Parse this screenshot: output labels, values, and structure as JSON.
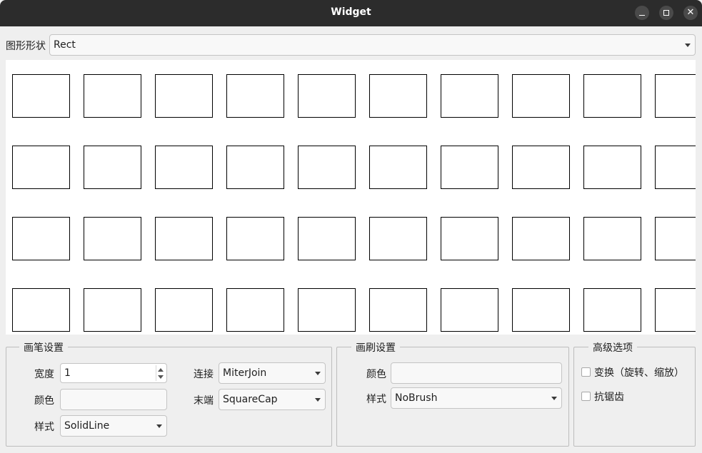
{
  "window": {
    "title": "Widget",
    "controls": {
      "minimize": "minimize-icon",
      "maximize": "maximize-icon",
      "close": "close-icon"
    }
  },
  "shape": {
    "label": "图形形状",
    "selected": "Rect"
  },
  "canvas": {
    "shape": "Rect",
    "rows": 4,
    "columns_visible": 10,
    "stroke_color": "#000000",
    "background": "#ffffff"
  },
  "pen": {
    "title": "画笔设置",
    "width_label": "宽度",
    "width_value": "1",
    "color_label": "颜色",
    "color_value": "",
    "style_label": "样式",
    "style_selected": "SolidLine",
    "join_label": "连接",
    "join_selected": "MiterJoin",
    "cap_label": "末端",
    "cap_selected": "SquareCap"
  },
  "brush": {
    "title": "画刷设置",
    "color_label": "颜色",
    "color_value": "",
    "style_label": "样式",
    "style_selected": "NoBrush"
  },
  "advanced": {
    "title": "高级选项",
    "transform_label": "变换（旋转、缩放）",
    "transform_checked": false,
    "antialias_label": "抗锯齿",
    "antialias_checked": false
  }
}
